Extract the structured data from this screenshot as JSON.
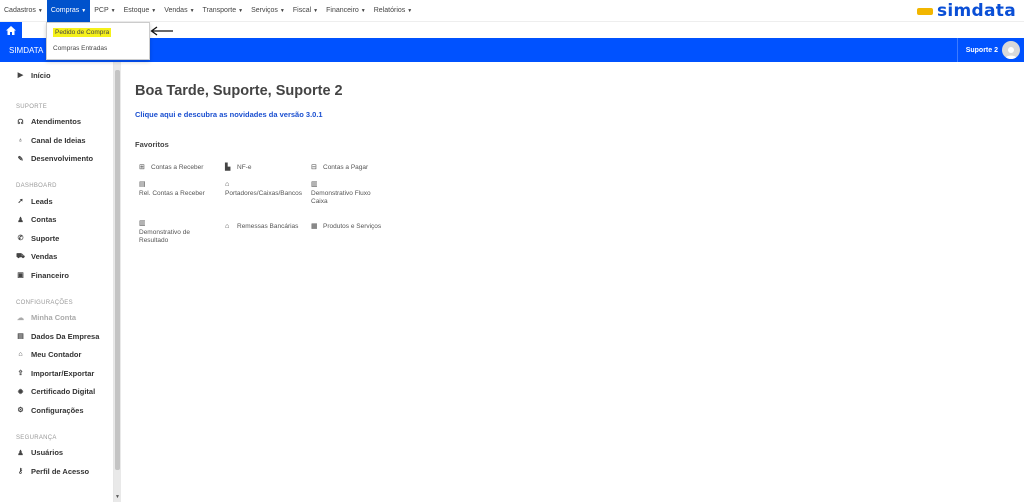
{
  "topmenu": {
    "items": [
      {
        "label": "Cadastros"
      },
      {
        "label": "Compras"
      },
      {
        "label": "PCP"
      },
      {
        "label": "Estoque"
      },
      {
        "label": "Vendas"
      },
      {
        "label": "Transporte"
      },
      {
        "label": "Serviços"
      },
      {
        "label": "Fiscal"
      },
      {
        "label": "Financeiro"
      },
      {
        "label": "Relatórios"
      }
    ],
    "logo_text": "simdata"
  },
  "dropdown": {
    "items": [
      {
        "label": "Pedido de Compra"
      },
      {
        "label": "Compras Entradas"
      }
    ]
  },
  "header": {
    "brand": "SIMDATA",
    "user_name": "Suporte 2"
  },
  "sidebar": {
    "inicio": "Início",
    "sections": {
      "suporte": "SUPORTE",
      "dashboard": "DASHBOARD",
      "configuracoes": "CONFIGURAÇÕES",
      "seguranca": "SEGURANÇA"
    },
    "suporte_items": [
      "Atendimentos",
      "Canal de Ideias",
      "Desenvolvimento"
    ],
    "dashboard_items": [
      "Leads",
      "Contas",
      "Suporte",
      "Vendas",
      "Financeiro"
    ],
    "config_items": [
      "Minha Conta",
      "Dados Da Empresa",
      "Meu Contador",
      "Importar/Exportar",
      "Certificado Digital",
      "Configurações"
    ],
    "seguranca_items": [
      "Usuários",
      "Perfil de Acesso"
    ]
  },
  "main": {
    "greeting": "Boa Tarde, Suporte, Suporte 2",
    "news_link": "Clique aqui e descubra as novidades da versão 3.0.1",
    "favorites_title": "Favoritos",
    "favorites": [
      "Contas a Receber",
      "NF-e",
      "Contas a Pagar",
      "Rel. Contas a Receber",
      "Portadores/Caixas/Bancos",
      "Demonstrativo Fluxo Caixa",
      "Demonstrativo de Resultado",
      "Remessas Bancárias",
      "Produtos e Serviços"
    ]
  },
  "colors": {
    "primary": "#0052ff",
    "menu_active": "#0052cc",
    "highlight": "#f5f11a",
    "link": "#1a4fd0"
  }
}
